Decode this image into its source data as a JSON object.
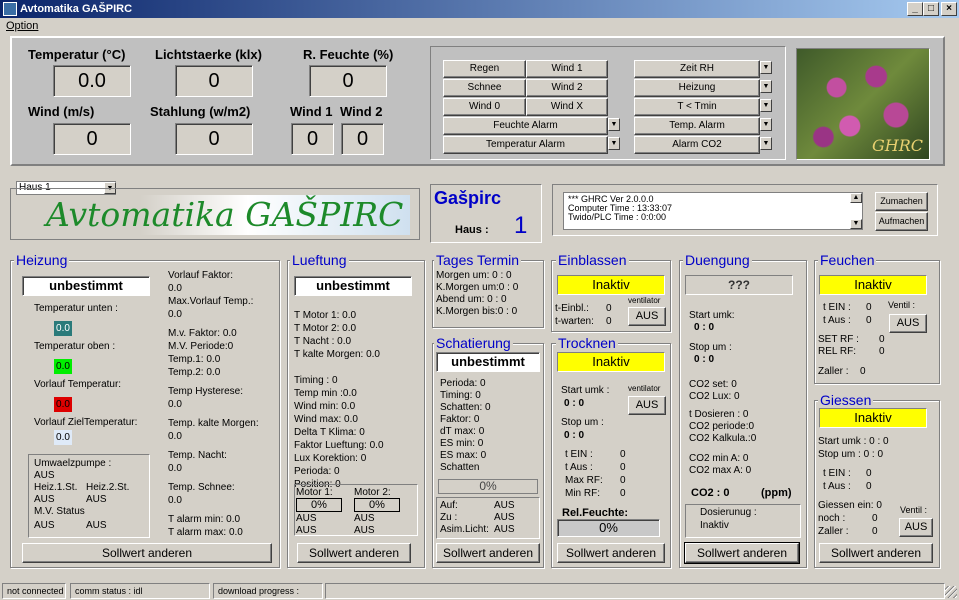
{
  "window": {
    "title": "Avtomatika GAŠPIRC",
    "min": "_",
    "max": "□",
    "close": "×"
  },
  "menu": {
    "option": "Option"
  },
  "meas": {
    "temp_label": "Temperatur (°C)",
    "temp": "0.0",
    "light_label": "Lichtstaerke (klx)",
    "light": "0",
    "rh_label": "R. Feuchte (%)",
    "rh": "0",
    "wind_label": "Wind (m/s)",
    "wind": "0",
    "rad_label": "Stahlung (w/m2)",
    "rad": "0",
    "w1_label": "Wind 1",
    "w1": "0",
    "w2_label": "Wind 2",
    "w2": "0"
  },
  "alarms": {
    "regen": "Regen",
    "wind1": "Wind 1",
    "schnee": "Schnee",
    "wind2": "Wind 2",
    "wind0": "Wind 0",
    "windx": "Wind X",
    "feuchte": "Feuchte Alarm",
    "temperatur": "Temperatur Alarm",
    "zeitrh": "Zeit RH",
    "heizung": "Heizung",
    "ttmin": "T < Tmin",
    "tempalarm": "Temp. Alarm",
    "alarmco2": "Alarm CO2"
  },
  "photo": {
    "caption": "GHRC"
  },
  "haus": {
    "select": "Haus 1",
    "logo": "Avtomatika GAŠPIRC",
    "name": "Gašpirc",
    "label": "Haus :",
    "num": "1"
  },
  "log": {
    "lines": [
      "*** GHRC Ver 2.0.0.0",
      "Computer Time   :  13:33:07",
      "Twido/PLC Time  :  0:0:00"
    ],
    "zumachen": "Zumachen",
    "aufmachen": "Aufmachen"
  },
  "heizung": {
    "title": "Heizung",
    "mode": "unbestimmt",
    "t_unten": "Temperatur unten :",
    "v_unten": "0.0",
    "t_oben": "Temperatur oben :",
    "v_oben": "0.0",
    "vorlauf": "Vorlauf Temperatur:",
    "v_vorlauf": "0.0",
    "ziel": "Vorlauf ZielTemperatur:",
    "v_ziel": "0.0",
    "pumpe": "Umwaelzpumpe :",
    "aus1": "AUS",
    "h1": "Heiz.1.St.",
    "h2": "Heiz.2.St.",
    "aus2": "AUS",
    "aus3": "AUS",
    "mv": "M.V. Status",
    "aus4": "AUS",
    "aus5": "AUS",
    "vf": "Vorlauf Faktor:",
    "vf_v": "0.0",
    "mvt": "Max.Vorlauf Temp.:",
    "mvt_v": "0.0",
    "mvf": "M.v. Faktor:   0.0",
    "mvp": "M.V. Periode:0",
    "t1": "Temp.1:   0.0",
    "t2": "Temp.2:   0.0",
    "hys": "Temp Hysterese:",
    "hys_v": "0.0",
    "tkm": "Temp. kalte Morgen:",
    "tkm_v": "0.0",
    "tn": "Temp. Nacht:",
    "tn_v": "0.0",
    "ts": "Temp. Schnee:",
    "ts_v": "0.0",
    "tamin": "T alarm min:  0.0",
    "tamax": "T alarm max:  0.0",
    "btn": "Sollwert anderen"
  },
  "lueftung": {
    "title": "Lueftung",
    "mode": "unbestimmt",
    "rows": [
      "T Motor 1:   0.0",
      "T Motor 2:   0.0",
      "T Nacht :    0.0",
      "T kalte Morgen:  0.0",
      "",
      "Timing  :    0",
      "Temp min :0.0",
      "Wind min:    0.0",
      "Wind max:   0.0",
      "Delta T Klima:       0",
      "Faktor Lueftung:       0.0",
      "Lux Korektion:       0",
      "Perioda:    0",
      "Position:    0"
    ],
    "m1": "Motor 1:",
    "m2": "Motor 2:",
    "p1": "0%",
    "p2": "0%",
    "a1": "AUS",
    "a2": "AUS",
    "a3": "AUS",
    "a4": "AUS",
    "btn": "Sollwert anderen"
  },
  "termin": {
    "title": "Tages Termin",
    "rows": [
      "Morgen um:   0   : 0",
      "K.Morgen um:0   : 0",
      "Abend um:     0   : 0",
      "K.Morgen bis:0   : 0"
    ]
  },
  "schat": {
    "title": "Schatierung",
    "mode": "unbestimmt",
    "rows": [
      "Perioda:   0",
      "Timing:    0",
      "Schatten:  0",
      "Faktor:     0",
      "dT max:    0",
      "ES min:     0",
      "ES max:    0",
      "Schatten"
    ],
    "pct": "0%",
    "auf": "Auf:",
    "auf_v": "AUS",
    "zu": "Zu :",
    "zu_v": "AUS",
    "asim": "Asim.Licht:",
    "asim_v": "AUS",
    "btn": "Sollwert anderen"
  },
  "einb": {
    "title": "Einblassen",
    "status": "Inaktiv",
    "vent": "ventilator",
    "einbl": "t-Einbl.:",
    "einbl_v": "0",
    "warten": "t-warten:",
    "warten_v": "0",
    "aus": "AUS"
  },
  "trock": {
    "title": "Trocknen",
    "status": "Inaktiv",
    "vent": "ventilator",
    "startumk": "Start umk :",
    "start_v": "0   :  0",
    "aus": "AUS",
    "stopum": "Stop um :",
    "stop_v": "0   :  0",
    "tein": "t EIN :",
    "tein_v": "0",
    "taus": "t Aus :",
    "taus_v": "0",
    "maxrf": "Max RF:",
    "maxrf_v": "0",
    "minrf": "Min RF:",
    "minrf_v": "0",
    "relf": "Rel.Feuchte:",
    "pct": "0%",
    "btn": "Sollwert anderen"
  },
  "dueng": {
    "title": "Duengung",
    "status": "???",
    "startumk": "Start umk:",
    "start_v": "0   :  0",
    "stopum": "Stop um :",
    "stop_v": "0   :  0",
    "rows": [
      "CO2 set:  0",
      "CO2 Lux:  0",
      "",
      "t Dosieren :    0",
      "CO2 periode:0",
      "CO2 Kalkula.:0",
      "",
      "CO2 min A:    0",
      "CO2 max A:    0"
    ],
    "co2": "CO2 : 0",
    "ppm": "(ppm)",
    "dos": "Dosierunug :",
    "dos_v": "Inaktiv",
    "btn": "Sollwert anderen"
  },
  "feuch": {
    "title": "Feuchen",
    "status": "Inaktiv",
    "tein": "t EIN :",
    "tein_v": "0",
    "taus": "t Aus :",
    "taus_v": "0",
    "ventil": "Ventil :",
    "aus": "AUS",
    "setrf": "SET RF :",
    "setrf_v": "0",
    "relrf": "REL RF:",
    "relrf_v": "0",
    "zaller": "Zaller :",
    "zaller_v": "0"
  },
  "giess": {
    "title": "Giessen",
    "status": "Inaktiv",
    "startumk": "Start umk :  0   :  0",
    "stopum": "Stop um :    0   :  0",
    "tein": "t EIN :",
    "tein_v": "0",
    "taus": "t Aus :",
    "taus_v": "0",
    "ein": "Giessen ein: 0",
    "noch": "noch :",
    "noch_v": "0",
    "zaller": "Zaller :",
    "zaller_v": "0",
    "ventil": "Ventil :",
    "aus": "AUS",
    "btn": "Sollwert anderen"
  },
  "statusbar": {
    "s1": "not connected",
    "s2": "comm status : idl",
    "s3": "download progress :"
  }
}
